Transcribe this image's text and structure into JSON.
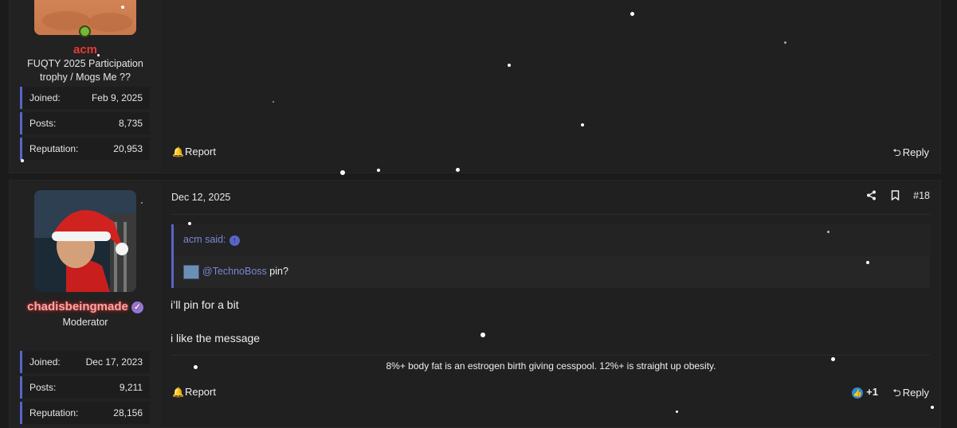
{
  "post_previous": {
    "user": {
      "name": "acm",
      "title": "FUQTY 2025 Participation trophy / Mogs Me ??",
      "online": true,
      "stats": [
        {
          "label": "Joined:",
          "value": "Feb 9, 2025"
        },
        {
          "label": "Posts:",
          "value": "8,735"
        },
        {
          "label": "Reputation:",
          "value": "20,953"
        }
      ]
    },
    "actions": {
      "report": "Report",
      "reply": "Reply"
    }
  },
  "post_current": {
    "user": {
      "name": "chadisbeingmade",
      "title": "Moderator",
      "verified": true,
      "stats": [
        {
          "label": "Joined:",
          "value": "Dec 17, 2023"
        },
        {
          "label": "Posts:",
          "value": "9,211"
        },
        {
          "label": "Reputation:",
          "value": "28,156"
        }
      ]
    },
    "date": "Dec 12, 2025",
    "number": "#18",
    "icons": {
      "share": "share-icon",
      "bookmark": "bookmark-icon"
    },
    "quote": {
      "author_line": "acm said:",
      "mention": "@TechnoBoss",
      "text": " pin?"
    },
    "message": [
      "i’ll pin for a bit",
      "i like the message"
    ],
    "signature": "8%+ body fat is an estrogen birth giving cesspool. 12%+ is straight up obesity.",
    "reactions": {
      "count": "+1",
      "icon": "like-icon"
    },
    "actions": {
      "report": "Report",
      "reply": "Reply"
    }
  },
  "colors": {
    "background": "#1b1b1b",
    "panel": "#202020",
    "accent": "#5865c8",
    "username_red": "#e53935",
    "moderator_glow": "#c9302c",
    "online_green": "#7ab536"
  }
}
